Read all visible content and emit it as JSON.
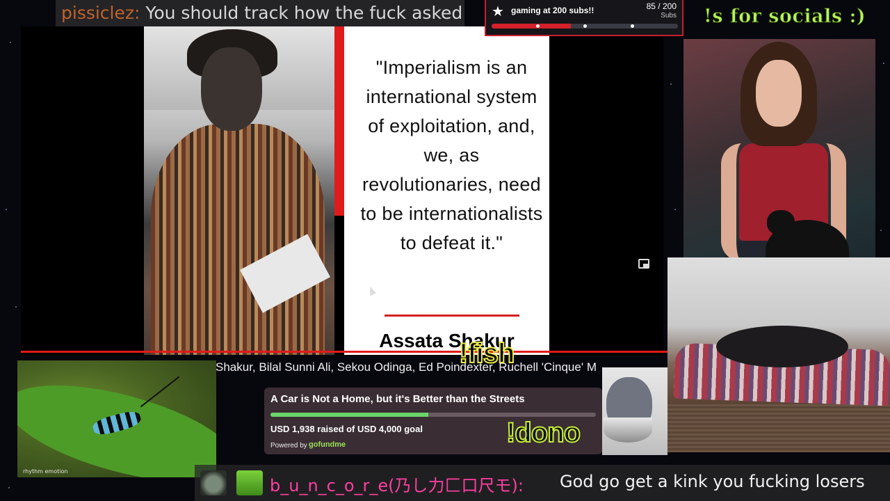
{
  "top_chat": {
    "username": "pissiclez:",
    "message": "You should track how the fuck asked"
  },
  "video": {
    "quote": "\"Imperialism is an international system of exploitation, and, we, as revolutionaries, need to be internationalists to defeat it.\"",
    "author": "Assata Shakur",
    "ticker": "Shakur, Bilal Sunni Ali, Sekou Odinga, Ed Poindexter, Ruchell 'Cinque' M"
  },
  "sub_goal": {
    "title": "gaming at 200 subs!!",
    "count": "85 / 200",
    "unit": "Subs",
    "progress_fraction": 0.425,
    "icon": "star-icon",
    "accent_color": "#d4202a"
  },
  "socials": "!s for socials :)",
  "commands": {
    "fish": "!fish",
    "dono": "!dono"
  },
  "fundraiser": {
    "title": "A Car is Not a Home, but it's Better than the Streets",
    "raised_text": "USD 1,938 raised of USD 4,000 goal",
    "raised": 1938,
    "goal": 4000,
    "powered_by": "Powered by",
    "logo": "gofundme",
    "accent_color": "#6bd46b"
  },
  "beetle_cam": {
    "watermark": "rhythm emotion"
  },
  "bottom_chat": {
    "username": "b_u_n_c_o_r_e(乃し力匚口尺モ):",
    "message": "God go get a kink you fucking losers"
  }
}
